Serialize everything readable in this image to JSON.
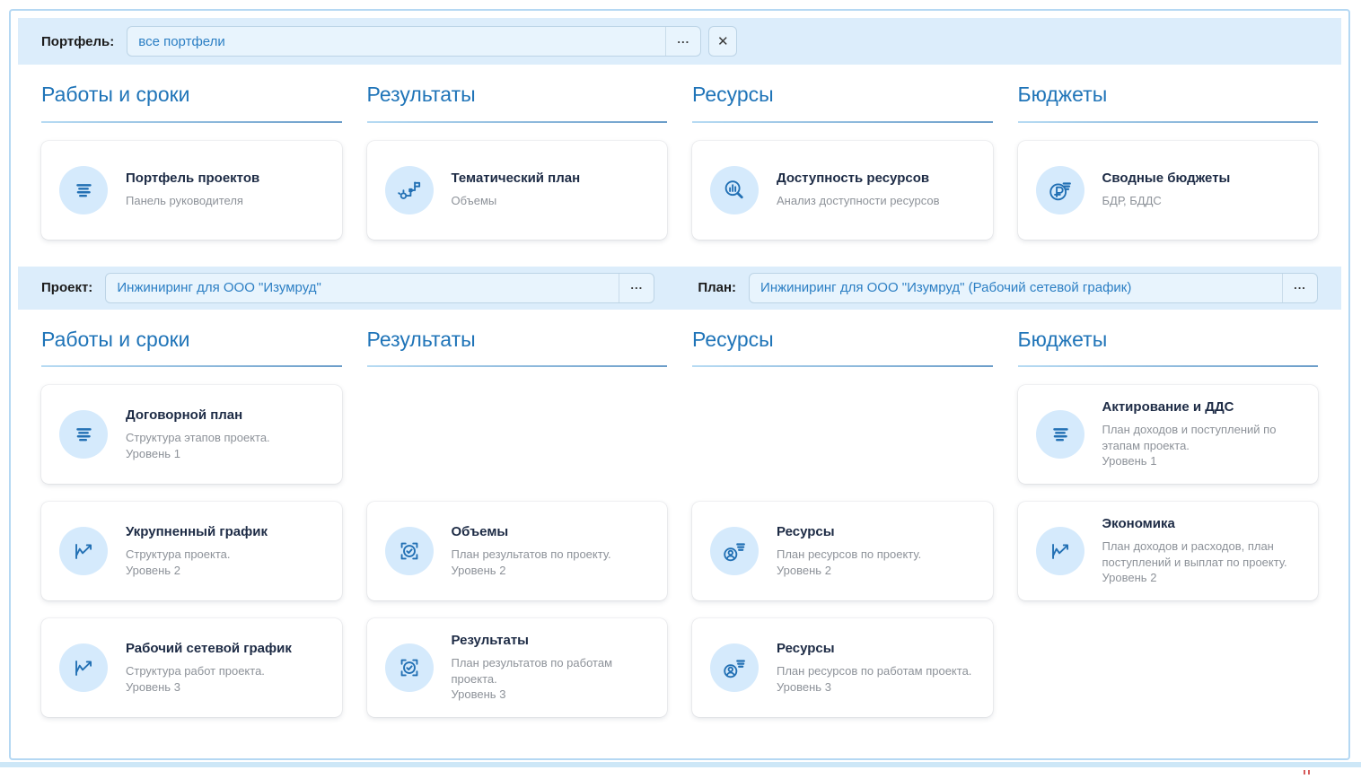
{
  "colors": {
    "accent_blue": "#1f74b8",
    "filter_bar_bg": "#dcedfb",
    "input_bg": "#e8f4fd",
    "input_text": "#2c7fc4",
    "icon_circle_bg": "#d5eafc",
    "icon_stroke": "#2270b4",
    "frame_border": "#b5d8f3"
  },
  "filters": {
    "portfolio": {
      "label": "Портфель:",
      "value": "все портфели",
      "more": "...",
      "clear": "✕"
    },
    "project": {
      "label": "Проект:",
      "value": "Инжиниринг для ООО \"Изумруд\"",
      "more": "..."
    },
    "plan": {
      "label": "План:",
      "value": "Инжиниринг для ООО \"Изумруд\" (Рабочий сетевой график)",
      "more": "..."
    }
  },
  "sections": {
    "portfolio": {
      "columns": [
        {
          "title": "Работы и сроки",
          "cards": [
            {
              "icon": "list-icon",
              "title": "Портфель проектов",
              "subtitle": "Панель руководителя"
            }
          ]
        },
        {
          "title": "Результаты",
          "cards": [
            {
              "icon": "workflow-icon",
              "title": "Тематический план",
              "subtitle": "Объемы"
            }
          ]
        },
        {
          "title": "Ресурсы",
          "cards": [
            {
              "icon": "search-chart-icon",
              "title": "Доступность ресурсов",
              "subtitle": "Анализ доступности ресурсов"
            }
          ]
        },
        {
          "title": "Бюджеты",
          "cards": [
            {
              "icon": "ruble-icon",
              "title": "Сводные бюджеты",
              "subtitle": "БДР, БДДС"
            }
          ]
        }
      ]
    },
    "project": {
      "columns": [
        {
          "title": "Работы и сроки",
          "cards": [
            {
              "icon": "list-icon",
              "title": "Договорной план",
              "subtitle": "Структура этапов проекта.\nУровень 1"
            },
            {
              "icon": "chart-icon",
              "title": "Укрупненный график",
              "subtitle": "Структура проекта.\nУровень 2"
            },
            {
              "icon": "chart-icon",
              "title": "Рабочий сетевой график",
              "subtitle": "Структура работ проекта.\nУровень 3"
            }
          ]
        },
        {
          "title": "Результаты",
          "cards": [
            {
              "icon": "target-icon",
              "title": "Объемы",
              "subtitle": "План результатов по проекту.\nУровень 2"
            },
            {
              "icon": "target-icon",
              "title": "Результаты",
              "subtitle": "План результатов по работам проекта.\nУровень 3"
            }
          ]
        },
        {
          "title": "Ресурсы",
          "cards": [
            {
              "icon": "person-lines-icon",
              "title": "Ресурсы",
              "subtitle": "План ресурсов по проекту.\nУровень 2"
            },
            {
              "icon": "person-lines-icon",
              "title": "Ресурсы",
              "subtitle": "План ресурсов по работам проекта.\nУровень 3"
            }
          ]
        },
        {
          "title": "Бюджеты",
          "cards": [
            {
              "icon": "list-icon",
              "title": "Актирование и ДДС",
              "subtitle": "План доходов и поступлений по этапам проекта.\nУровень 1"
            },
            {
              "icon": "chart-icon",
              "title": "Экономика",
              "subtitle": "План доходов и расходов, план поступлений и выплат по проекту.\nУровень 2"
            }
          ]
        }
      ]
    }
  }
}
